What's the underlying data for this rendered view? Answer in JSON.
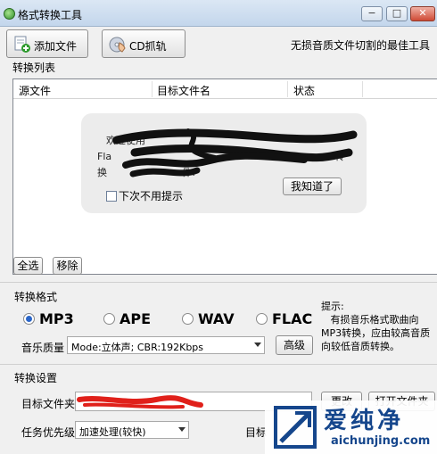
{
  "window": {
    "title": "格式转换工具",
    "buttons": {
      "minimize": "−",
      "maximize": "□",
      "close": "✕"
    }
  },
  "toolbar": {
    "add_file_label": "添加文件",
    "cd_rip_label": "CD抓轨",
    "slogan": "无损音质文件切割的最佳工具"
  },
  "convert_list": {
    "section_label": "转换列表",
    "columns": [
      "源文件",
      "目标文件名",
      "状态"
    ]
  },
  "tip": {
    "visible_fragments": [
      "欢迎使用",
      "换",
      "Fla",
      "件",
      "转",
      "！",
      "件!"
    ],
    "dont_show_label": "下次不用提示",
    "ok_label": "我知道了"
  },
  "list_buttons": {
    "select_all": "全选",
    "remove": "移除"
  },
  "format": {
    "section_label": "转换格式",
    "options": [
      "MP3",
      "APE",
      "WAV",
      "FLAC"
    ],
    "selected": "MP3",
    "quality_label": "音乐质量",
    "quality_value": "Mode:立体声; CBR:192Kbps",
    "advanced_label": "高级",
    "hint": "提示:\n   有损音乐格式歌曲向MP3转换，应由较高音质向较低音质转换。"
  },
  "settings": {
    "section_label": "转换设置",
    "target_folder_label": "目标文件夹",
    "change_label": "更改",
    "open_folder_label": "打开文件夹",
    "priority_label": "任务优先级",
    "priority_value": "加速处理(较快)",
    "target_partial_label": "目标"
  },
  "watermark": {
    "name": "爱纯净",
    "url": "aichunjing.com"
  },
  "colors": {
    "accent": "#2b66c8",
    "watermark": "#15468c",
    "redaction": "#e0201a"
  }
}
